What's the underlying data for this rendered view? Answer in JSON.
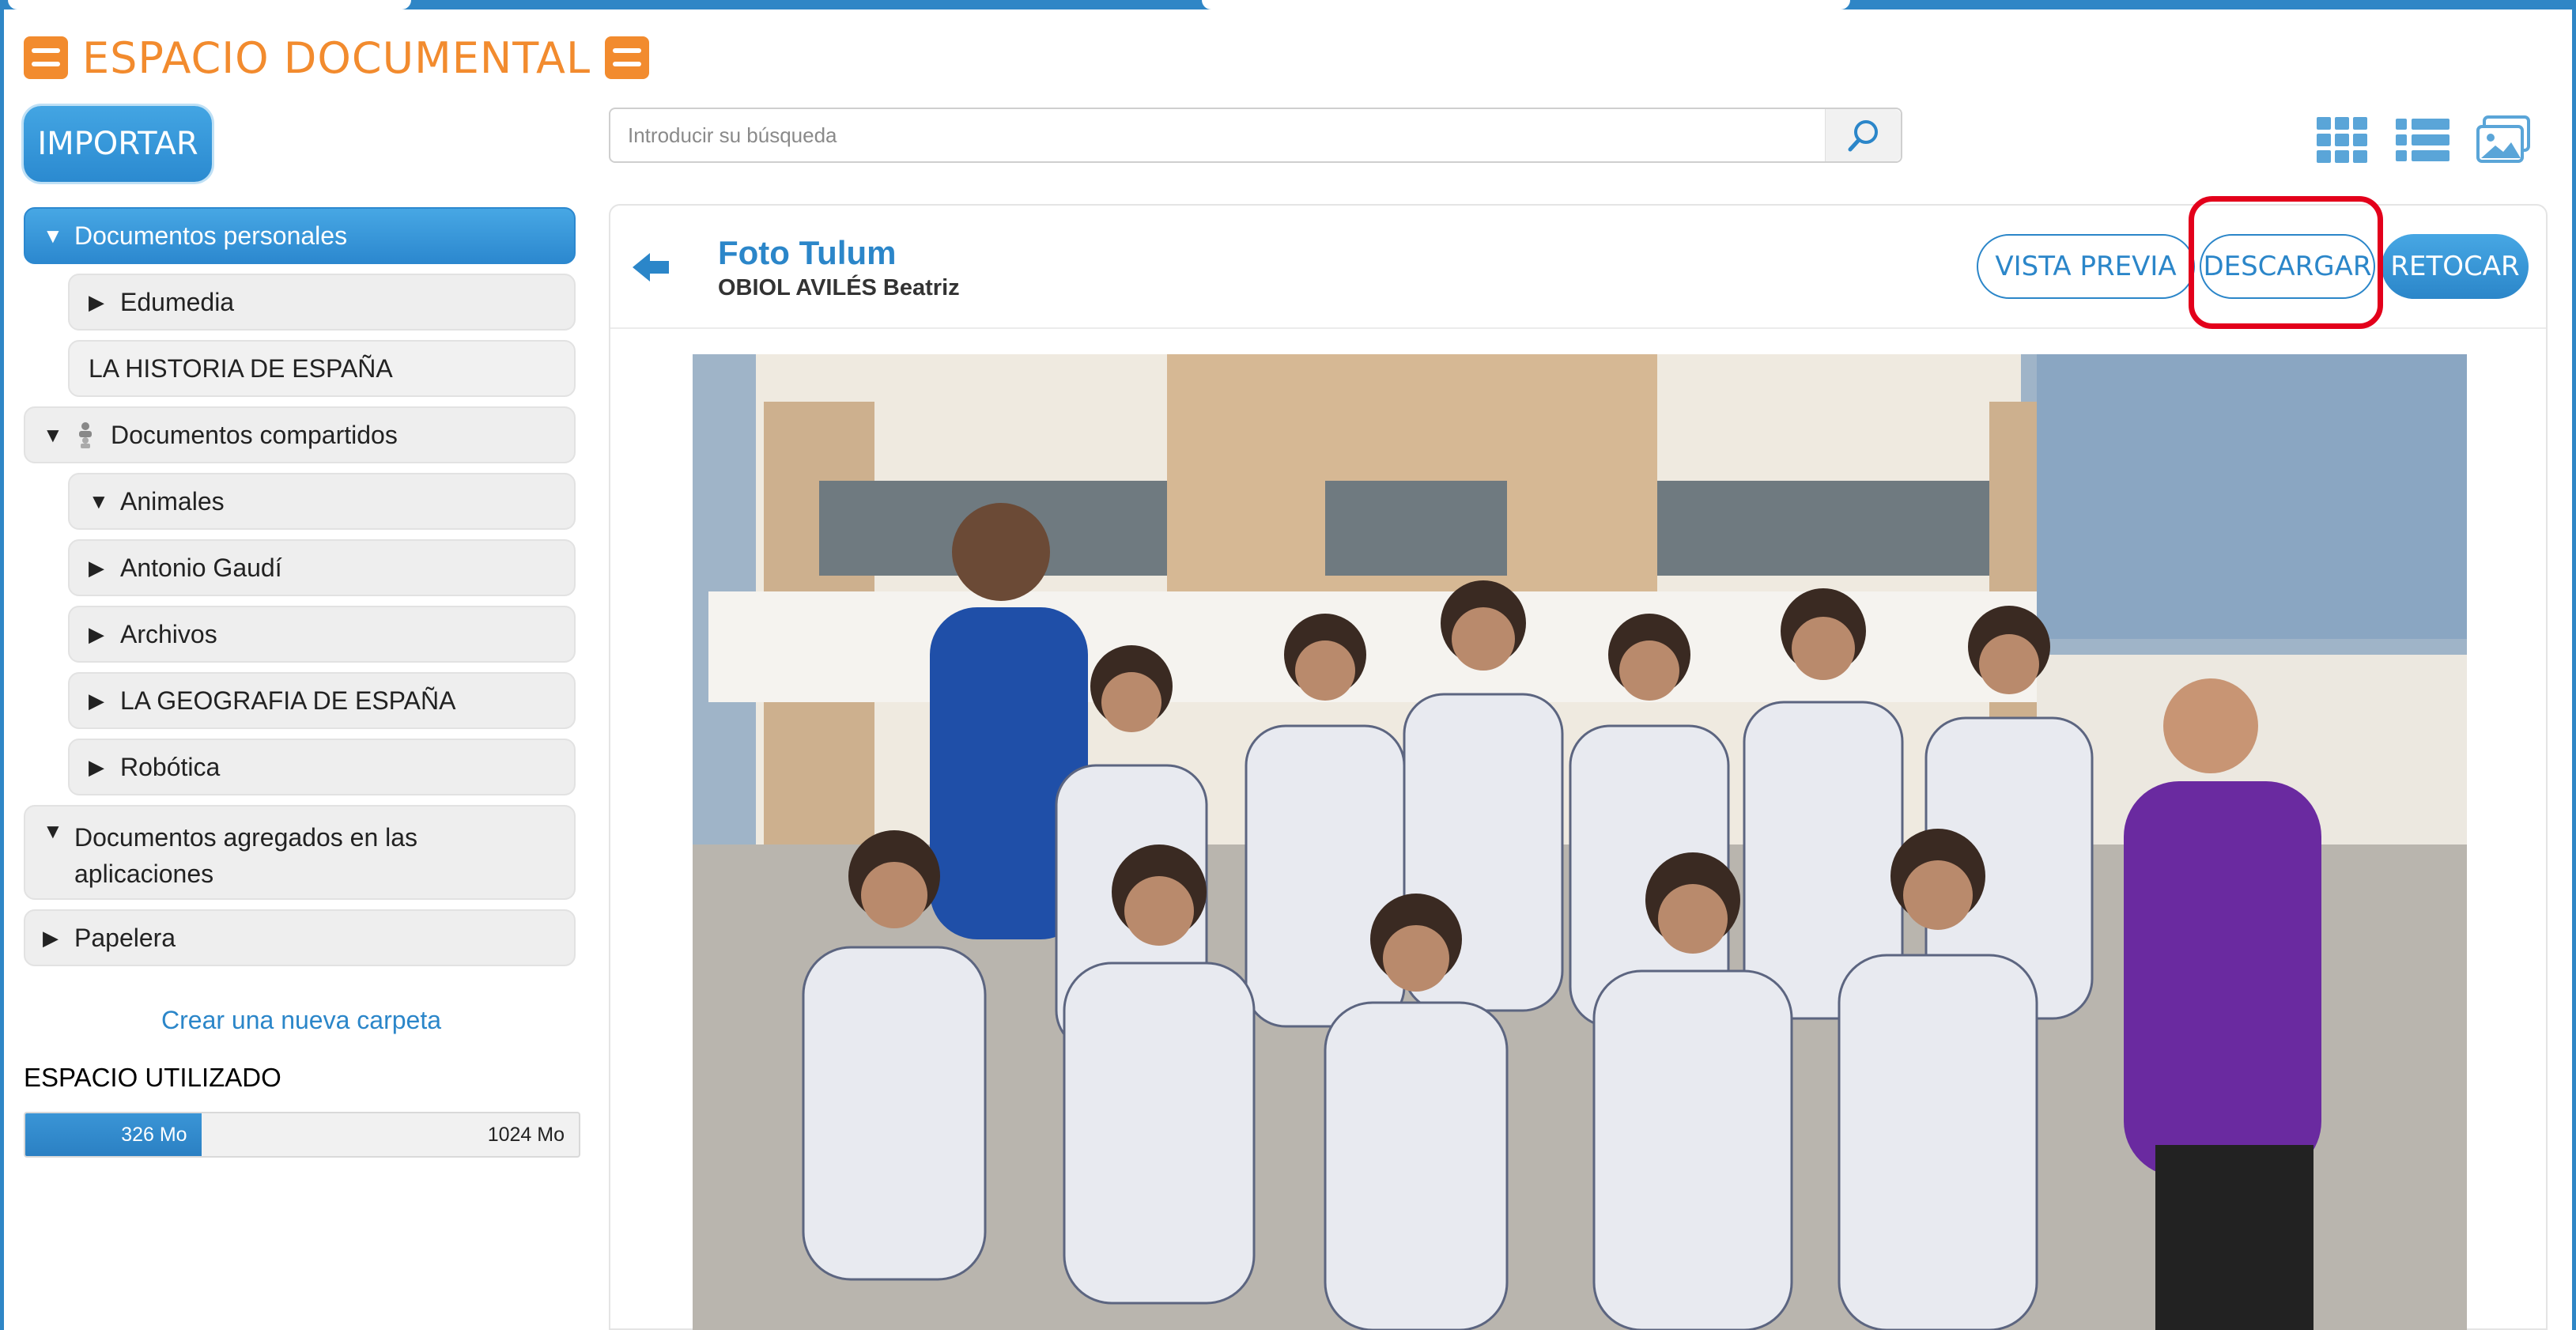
{
  "app": {
    "title": "ESPACIO DOCUMENTAL",
    "import_label": "IMPORTAR"
  },
  "search": {
    "placeholder": "Introducir su búsqueda",
    "value": ""
  },
  "view_modes": [
    "grid-view-icon",
    "list-view-icon",
    "gallery-view-icon"
  ],
  "sidebar": {
    "items": [
      {
        "label": "Documentos personales",
        "arrow": "▼",
        "active": true
      },
      {
        "label": "Edumedia",
        "arrow": "▶"
      },
      {
        "label": "LA HISTORIA DE ESPAÑA",
        "arrow": ""
      },
      {
        "label": "Documentos compartidos",
        "arrow": "▼"
      },
      {
        "label": "Animales",
        "arrow": "▼"
      },
      {
        "label": "Antonio Gaudí",
        "arrow": "▶"
      },
      {
        "label": "Archivos",
        "arrow": "▶"
      },
      {
        "label": "LA GEOGRAFIA DE ESPAÑA",
        "arrow": "▶"
      },
      {
        "label": "Robótica",
        "arrow": "▶"
      },
      {
        "label": "Documentos agregados en las aplicaciones",
        "arrow": "▼"
      },
      {
        "label": "Papelera",
        "arrow": "▶"
      }
    ],
    "new_folder_link": "Crear una nueva carpeta",
    "space": {
      "title": "ESPACIO UTILIZADO",
      "used_label": "326 Mo",
      "total_label": "1024 Mo",
      "used_fraction": 0.318
    }
  },
  "document": {
    "title": "Foto Tulum",
    "author": "OBIOL AVILÉS Beatriz",
    "actions": {
      "preview": "VISTA PREVIA",
      "download": "DESCARGAR",
      "retouch": "RETOCAR"
    }
  },
  "colors": {
    "brand_orange": "#f28b2e",
    "primary_blue": "#2b86c9",
    "highlight_red": "#e3001b"
  }
}
